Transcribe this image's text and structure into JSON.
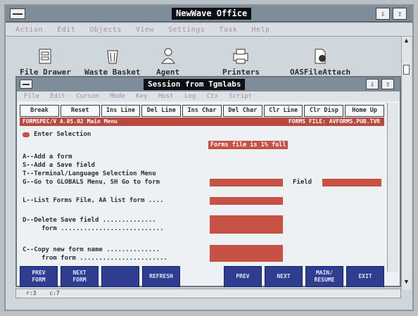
{
  "outer": {
    "title": "NewWave Office",
    "btn_min": "⇩",
    "btn_max": "⇧",
    "menu": [
      "Action",
      "Edit",
      "Objects",
      "View",
      "Settings",
      "Task",
      "Help"
    ]
  },
  "desktop_icons": [
    {
      "label": "File Drawer",
      "icon": "file-drawer-icon"
    },
    {
      "label": "Waste Basket",
      "icon": "waste-basket-icon"
    },
    {
      "label": "Agent",
      "icon": "agent-icon"
    },
    {
      "label": "Printers",
      "icon": "printers-icon"
    },
    {
      "label": "OASFileAttach",
      "icon": "file-attach-icon"
    }
  ],
  "session": {
    "title": "Session from Tgmlabs",
    "btn_min": "⇩",
    "btn_max": "⇧",
    "menu": [
      "File",
      "Edit",
      "Curson",
      "Mode",
      "Key",
      "Host",
      "Log",
      "Ctx",
      "Script"
    ],
    "fkeys": [
      "Break",
      "Reset",
      "Ins Line",
      "Del Line",
      "Ins Char",
      "Del Char",
      "Clr Line",
      "Clr Disp",
      "Home Up"
    ],
    "status_left": "FORMSPEC/V A.05.02 Main Menu",
    "status_right": "FORMS FILE: AVFORMS.PUB.TVR",
    "enter_selection": "Enter Selection",
    "full_banner": "Forms file is 1% full",
    "options": [
      "A--Add a form",
      "S--Add a Save field",
      "T--Terminal/Language Selection Menu",
      "G--Go to GLOBALS Menu, SH Go to form"
    ],
    "field_label": "Field",
    "list_line": "L--List Forms File, AA list form ....",
    "delete_line1": "D--Delete Save field ..............",
    "delete_line2": "     form ...........................",
    "copy_line1": "C--Copy new form name ..............",
    "copy_line2": "     from form .......................",
    "softkeys": [
      "PREV\nFORM",
      "NEXT\nFORM",
      "",
      "REFRESH",
      "PREV",
      "NEXT",
      "MAIN/\nRESUME",
      "EXIT"
    ],
    "bottom_status": [
      "r:3",
      "c:7"
    ]
  },
  "colors": {
    "accent_red": "#c65245",
    "softkey_blue": "#2e3d8f",
    "titlebar": "#7f8c99"
  }
}
